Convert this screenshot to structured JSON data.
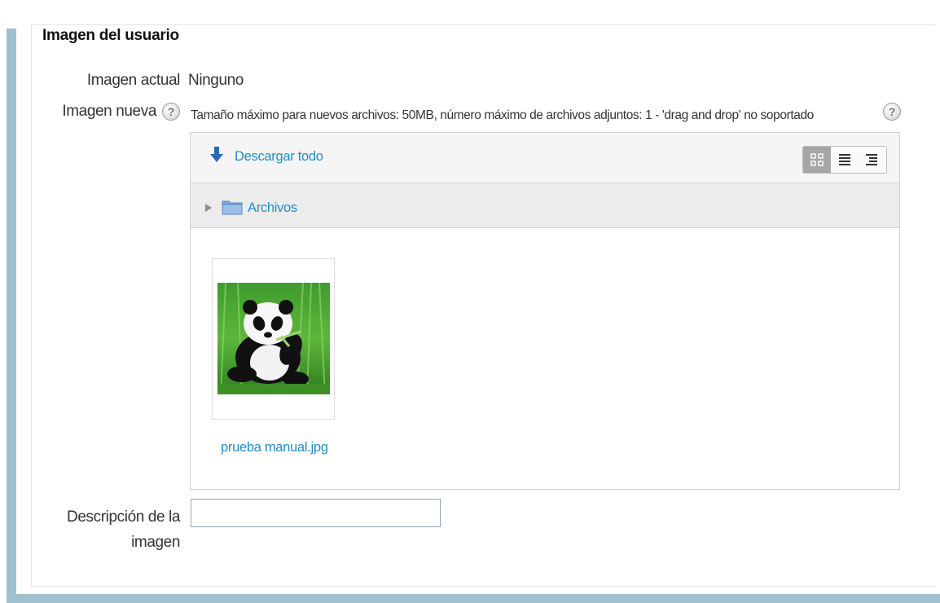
{
  "section": {
    "legend": "Imagen del usuario"
  },
  "current_image": {
    "label": "Imagen actual",
    "value": "Ninguno"
  },
  "new_image": {
    "label": "Imagen nueva",
    "help_icon": "help-icon",
    "limits_text": "Tamaño máximo para nuevos archivos: 50MB, número máximo de archivos adjuntos: 1 - 'drag and drop' no soportado"
  },
  "filemanager": {
    "download_all_label": "Descargar todo",
    "download_icon": "down-arrow-icon",
    "view_modes": [
      "icons-view-icon",
      "list-view-icon",
      "tree-view-icon"
    ],
    "active_view": "icons-view-icon",
    "path_label": "Archivos",
    "files": [
      {
        "name": "prueba manual.jpg",
        "thumbnail": "panda-photo"
      }
    ]
  },
  "description": {
    "label_line1": "Descripción de la",
    "label_line2": "imagen",
    "value": ""
  },
  "colors": {
    "link": "#1f8ecf",
    "frame": "#9fc0cd",
    "toolbar_bg": "#f5f5f5",
    "path_bg": "#ececec"
  }
}
